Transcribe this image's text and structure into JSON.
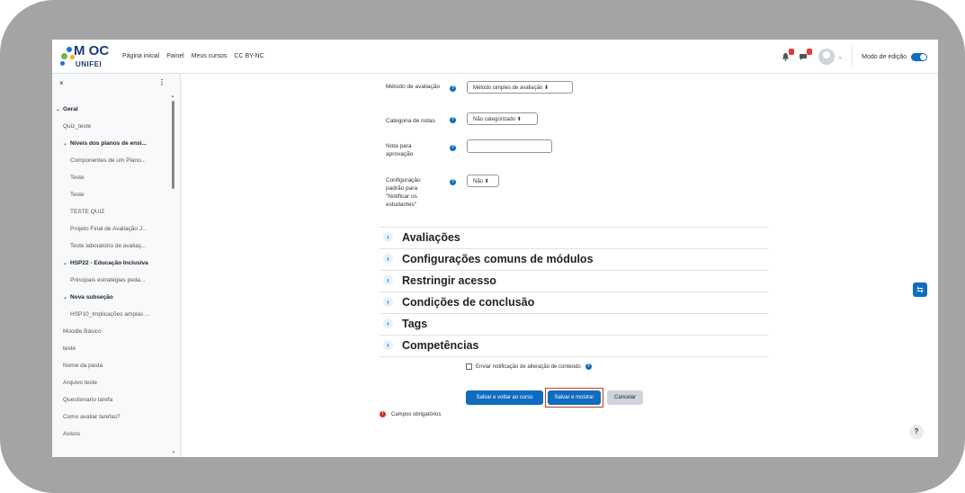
{
  "logo": {
    "main": "M OC",
    "sub": "UNIFEI"
  },
  "navbar": {
    "links": [
      "Página inicial",
      "Painel",
      "Meus cursos",
      "CC BY-NC"
    ],
    "edit_mode_label": "Modo de edição",
    "notification_icon": "bell-icon",
    "message_icon": "chat-icon"
  },
  "drawer": {
    "close": "×",
    "more": "⋮",
    "items": [
      {
        "label": "Geral",
        "type": "section"
      },
      {
        "label": "Quiz_teste",
        "type": "item"
      },
      {
        "label": "Níveis dos planos de ensi...",
        "type": "section"
      },
      {
        "label": "Componentes de um Plano...",
        "type": "item"
      },
      {
        "label": "Teste",
        "type": "item"
      },
      {
        "label": "Teste",
        "type": "item"
      },
      {
        "label": "TESTE QUIZ",
        "type": "item"
      },
      {
        "label": "Projeto Final de Avaliação J...",
        "type": "item"
      },
      {
        "label": "Teste laboratório de avaliaç...",
        "type": "item"
      },
      {
        "label": "HSP22 - Educação Inclusiva",
        "type": "section"
      },
      {
        "label": "Principais estratégias peda...",
        "type": "item"
      },
      {
        "label": "Nova subseção",
        "type": "section"
      },
      {
        "label": "HSP10_Implicações amplas ...",
        "type": "item"
      },
      {
        "label": "Moodle Básico",
        "type": "item"
      },
      {
        "label": "teste",
        "type": "item"
      },
      {
        "label": "Nome da pasta",
        "type": "item"
      },
      {
        "label": "Arquivo teste",
        "type": "item"
      },
      {
        "label": "Questionario tarefa",
        "type": "item"
      },
      {
        "label": "Como avaliar tarefas?",
        "type": "item"
      },
      {
        "label": "Avisos",
        "type": "item"
      }
    ]
  },
  "form": {
    "method_label": "Método de avaliação",
    "method_value": "Método simples de avaliação ⬍",
    "category_label": "Categoria de notas",
    "category_value": "Não categorizado ⬍",
    "pass_label": "Nota para aprovação",
    "pass_value": "",
    "notify_default_label": "Configuração padrão para \"Notificar os estudantes\"",
    "notify_default_value": "Não ⬍",
    "sections": [
      "Avaliações",
      "Configurações comuns de módulos",
      "Restringir acesso",
      "Condições de conclusão",
      "Tags",
      "Competências"
    ],
    "notify_change_label": "Enviar notificação de alteração de conteúdo",
    "notify_change_checked": false,
    "buttons": {
      "save_return": "Salvar e voltar ao curso",
      "save_display": "Salvar e mostrar",
      "cancel": "Cancelar"
    },
    "required_note": "Campos obrigatórios"
  },
  "floating": {
    "help": "?"
  },
  "colors": {
    "primary": "#0f6cbf",
    "highlight": "#c0392b",
    "frame": "#a4a4a4"
  }
}
